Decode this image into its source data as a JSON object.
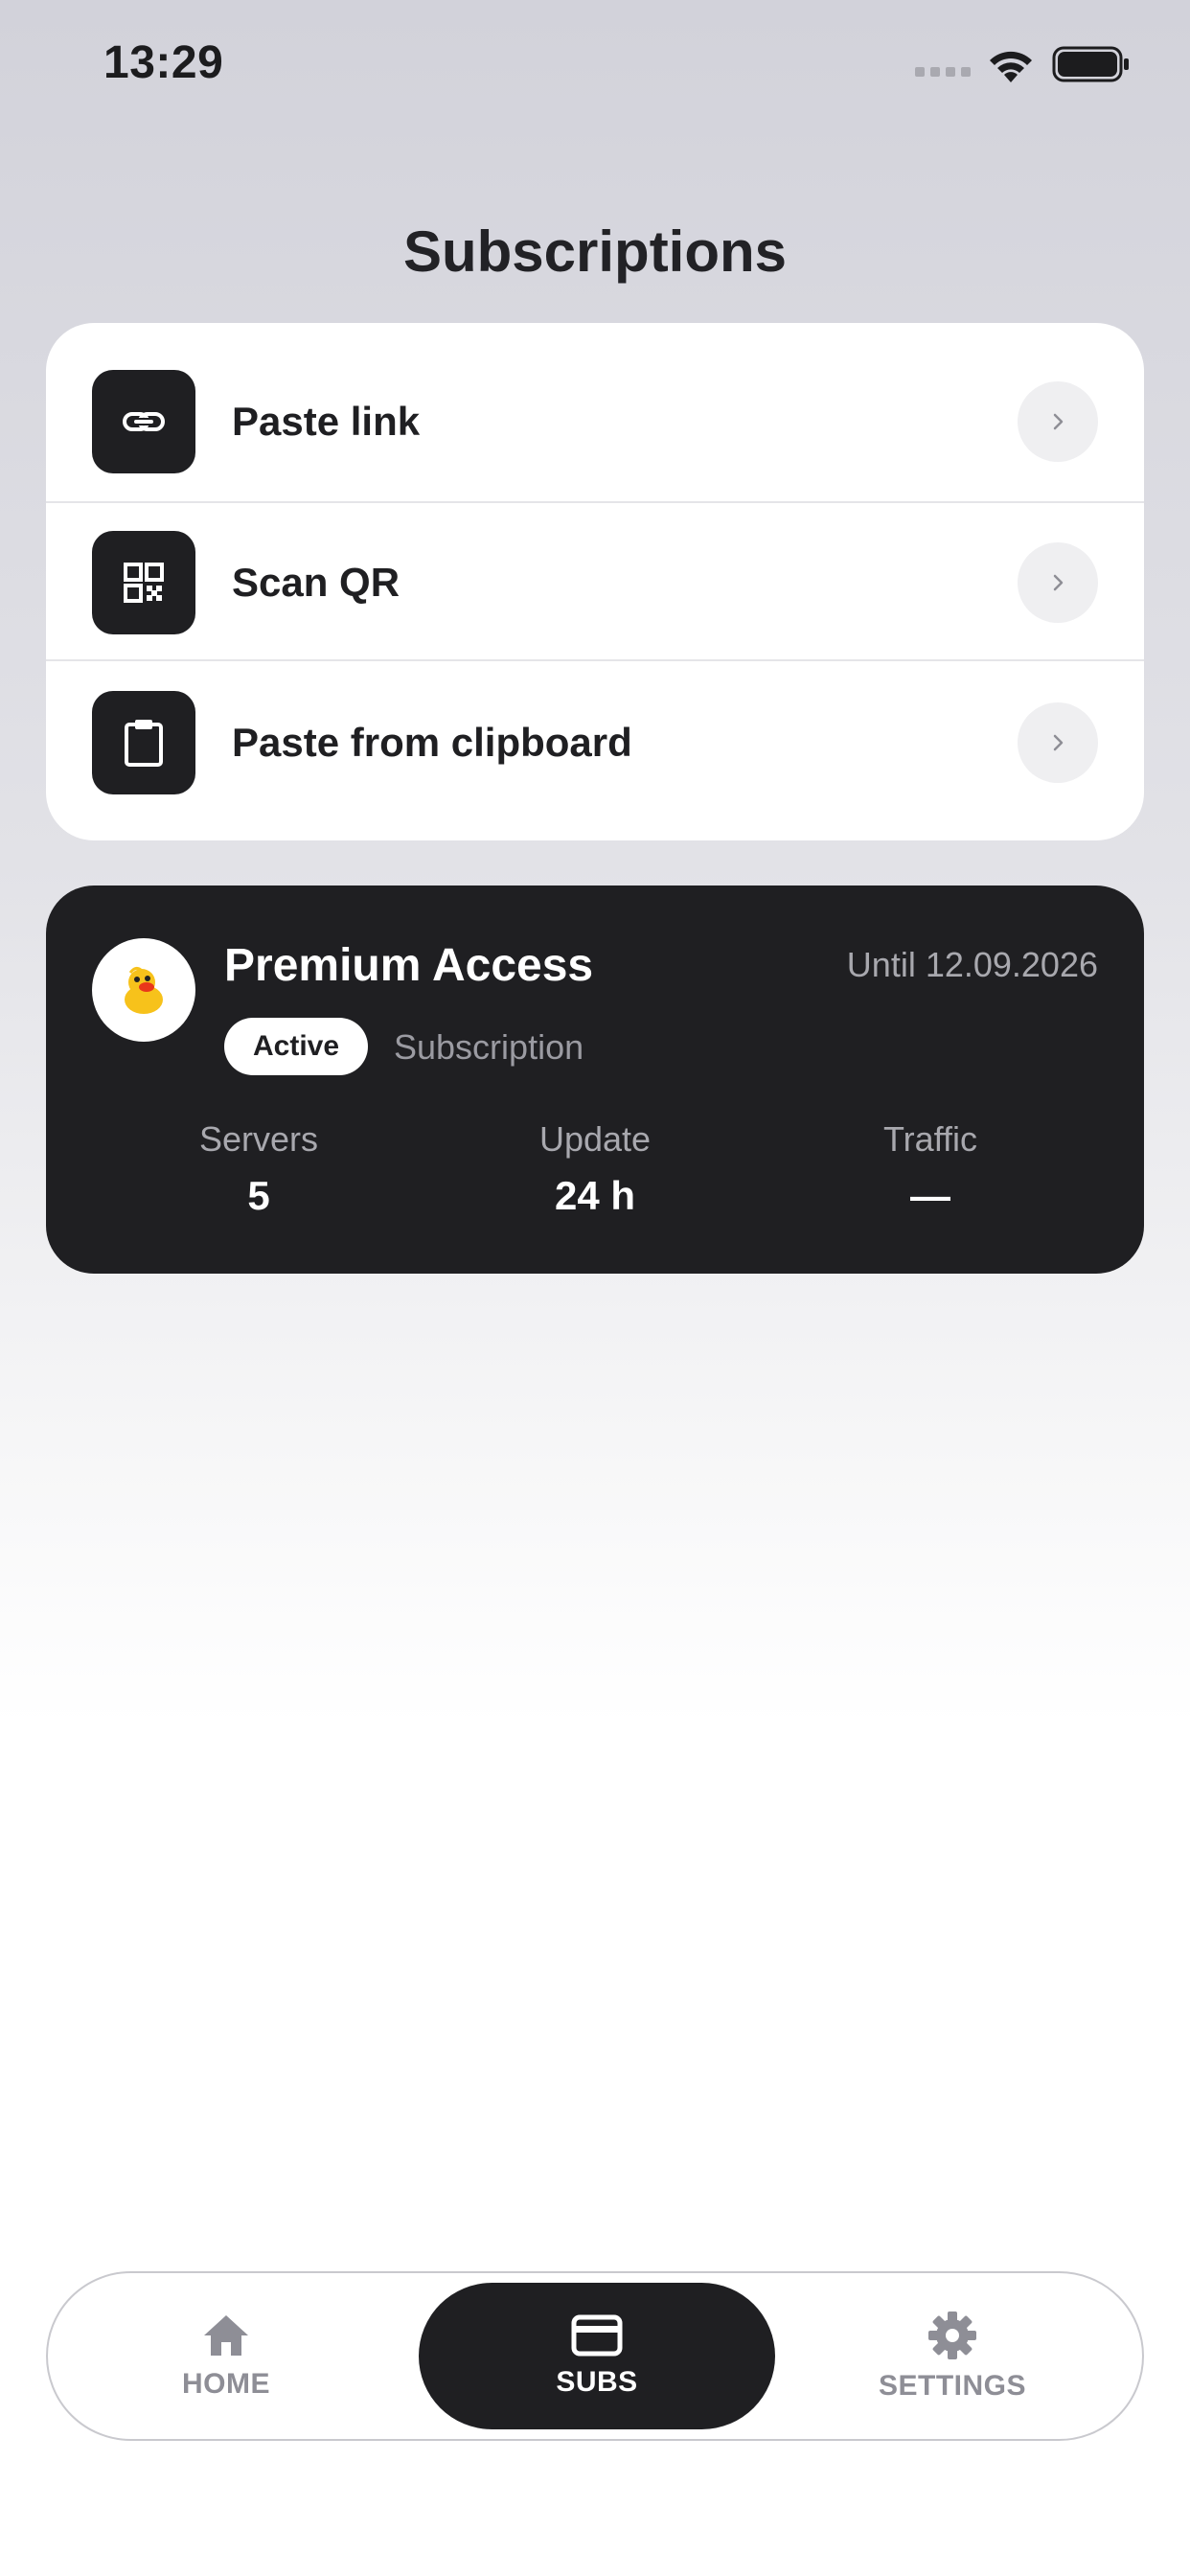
{
  "status_bar": {
    "time": "13:29"
  },
  "header": {
    "title": "Subscriptions"
  },
  "actions": [
    {
      "label": "Paste link",
      "icon": "link-icon"
    },
    {
      "label": "Scan QR",
      "icon": "qr-code-icon"
    },
    {
      "label": "Paste from clipboard",
      "icon": "clipboard-icon"
    }
  ],
  "subscription": {
    "name": "Premium Access",
    "until": "Until 12.09.2026",
    "status": "Active",
    "type": "Subscription",
    "avatar_icon": "duck-icon",
    "stats": [
      {
        "label": "Servers",
        "value": "5"
      },
      {
        "label": "Update",
        "value": "24 h"
      },
      {
        "label": "Traffic",
        "value": "—"
      }
    ]
  },
  "tabs": [
    {
      "label": "HOME",
      "icon": "home-icon"
    },
    {
      "label": "SUBS",
      "icon": "card-icon",
      "active": true
    },
    {
      "label": "SETTINGS",
      "icon": "gear-icon"
    }
  ],
  "colors": {
    "dark": "#1f1f22",
    "muted": "#8e8e96",
    "chevron_bg": "#efeff1"
  }
}
